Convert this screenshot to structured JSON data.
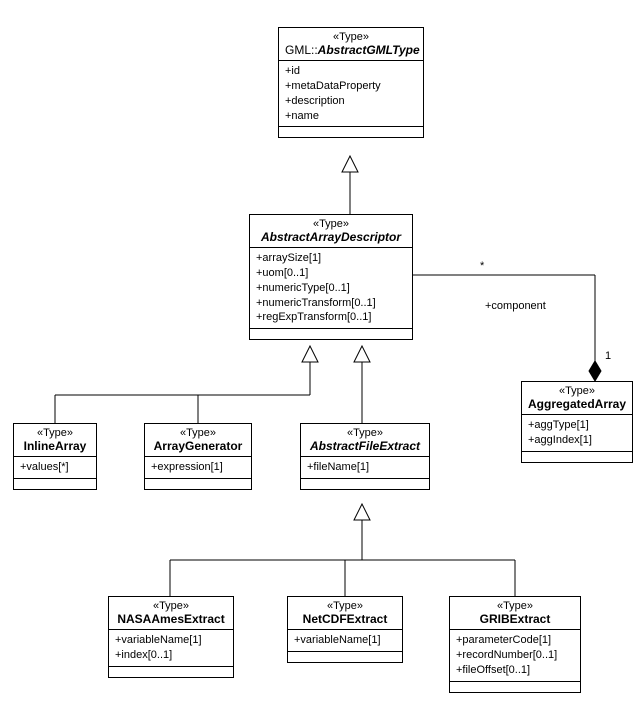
{
  "classes": {
    "abstractGMLType": {
      "stereotype": "«Type»",
      "namePrefix": "GML::",
      "name": "AbstractGMLType",
      "abstract": true,
      "attrs": [
        "+id",
        "+metaDataProperty",
        "+description",
        "+name"
      ]
    },
    "abstractArrayDescriptor": {
      "stereotype": "«Type»",
      "name": "AbstractArrayDescriptor",
      "abstract": true,
      "attrs": [
        "+arraySize[1]",
        "+uom[0..1]",
        "+numericType[0..1]",
        "+numericTransform[0..1]",
        "+regExpTransform[0..1]"
      ]
    },
    "aggregatedArray": {
      "stereotype": "«Type»",
      "name": "AggregatedArray",
      "abstract": false,
      "attrs": [
        "+aggType[1]",
        "+aggIndex[1]"
      ]
    },
    "inlineArray": {
      "stereotype": "«Type»",
      "name": "InlineArray",
      "abstract": false,
      "attrs": [
        "+values[*]"
      ]
    },
    "arrayGenerator": {
      "stereotype": "«Type»",
      "name": "ArrayGenerator",
      "abstract": false,
      "attrs": [
        "+expression[1]"
      ]
    },
    "abstractFileExtract": {
      "stereotype": "«Type»",
      "name": "AbstractFileExtract",
      "abstract": true,
      "attrs": [
        "+fileName[1]"
      ]
    },
    "nasaAmesExtract": {
      "stereotype": "«Type»",
      "name": "NASAAmesExtract",
      "abstract": false,
      "attrs": [
        "+variableName[1]",
        "+index[0..1]"
      ]
    },
    "netCDFExtract": {
      "stereotype": "«Type»",
      "name": "NetCDFExtract",
      "abstract": false,
      "attrs": [
        "+variableName[1]"
      ]
    },
    "gribExtract": {
      "stereotype": "«Type»",
      "name": "GRIBExtract",
      "abstract": false,
      "attrs": [
        "+parameterCode[1]",
        "+recordNumber[0..1]",
        "+fileOffset[0..1]"
      ]
    }
  },
  "association": {
    "roleName": "+component",
    "multNearDescriptor": "*",
    "multNearAggregated": "1"
  }
}
